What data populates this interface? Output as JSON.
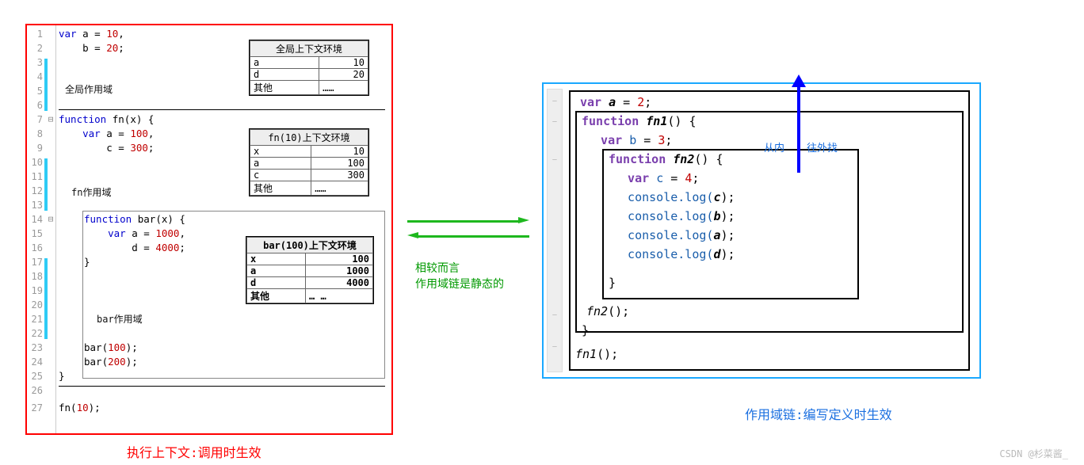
{
  "left": {
    "lines": [
      "1",
      "2",
      "3",
      "4",
      "5",
      "6",
      "7",
      "8",
      "9",
      "10",
      "11",
      "12",
      "13",
      "14",
      "15",
      "16",
      "17",
      "18",
      "19",
      "20",
      "21",
      "22",
      "23",
      "24",
      "25",
      "26",
      "27"
    ],
    "code": {
      "l1a": "var",
      "l1b": " a = ",
      "l1c": "10",
      "l1d": ",",
      "l2a": "    b = ",
      "l2b": "20",
      "l2c": ";",
      "scopeGlobal": "全局作用域",
      "l7a": "function",
      "l7b": " fn(x) {",
      "l8a": "    var",
      "l8b": " a = ",
      "l8c": "100",
      "l8d": ",",
      "l9a": "        c = ",
      "l9b": "300",
      "l9c": ";",
      "scopeFn": "fn作用域",
      "l14a": "function",
      "l14b": " bar(x) {",
      "l15a": "    var",
      "l15b": " a = ",
      "l15c": "1000",
      "l15d": ",",
      "l16a": "        d = ",
      "l16b": "4000",
      "l16c": ";",
      "l17": "}",
      "scopeBar": "bar作用域",
      "l23": "bar(",
      "l23n": "100",
      "l23e": ");",
      "l24": "bar(",
      "l24n": "200",
      "l24e": ");",
      "l25": "}",
      "l27": "fn(",
      "l27n": "10",
      "l27e": ");"
    },
    "ctxGlobal": {
      "title": "全局上下文环境",
      "rows": [
        [
          "a",
          "10"
        ],
        [
          "d",
          "20"
        ],
        [
          "其他",
          "……"
        ]
      ]
    },
    "ctxFn": {
      "title": "fn(10)上下文环境",
      "rows": [
        [
          "x",
          "10"
        ],
        [
          "a",
          "100"
        ],
        [
          "c",
          "300"
        ],
        [
          "其他",
          "……"
        ]
      ]
    },
    "ctxBar": {
      "title": "bar(100)上下文环境",
      "rows": [
        [
          "x",
          "100"
        ],
        [
          "a",
          "1000"
        ],
        [
          "d",
          "4000"
        ],
        [
          "其他",
          "…  …"
        ]
      ]
    },
    "caption": "执行上下文:调用时生效"
  },
  "mid": {
    "t1": "相较而言",
    "t2": "作用域链是静态的"
  },
  "right": {
    "l1a": "var ",
    "l1b": "a",
    "l1c": " = ",
    "l1d": "2",
    "l1e": ";",
    "l2a": "function ",
    "l2b": "fn1",
    "l2c": "() {",
    "l3a": "  var ",
    "l3b": "b",
    "l3c": " = ",
    "l3d": "3",
    "l3e": ";",
    "l4a": "function ",
    "l4b": "fn2",
    "l4c": "() {",
    "l5a": "  var ",
    "l5b": "c",
    "l5c": " = ",
    "l5d": "4",
    "l5e": ";",
    "l6": "  console.log(",
    "l6v": "c",
    "l6e": ");",
    "l7": "  console.log(",
    "l7v": "b",
    "l7e": ");",
    "l8": "  console.log(",
    "l8v": "a",
    "l8e": ");",
    "l9": "  console.log(",
    "l9v": "d",
    "l9e": ");",
    "l10": "}",
    "l11a": "fn2",
    "l11b": "();",
    "l12": "}",
    "l13a": "fn1",
    "l13b": "();",
    "note1": "从内",
    "note2": "往外找",
    "caption": "作用域链:编写定义时生效"
  },
  "watermark": "CSDN @杉菜酱_"
}
